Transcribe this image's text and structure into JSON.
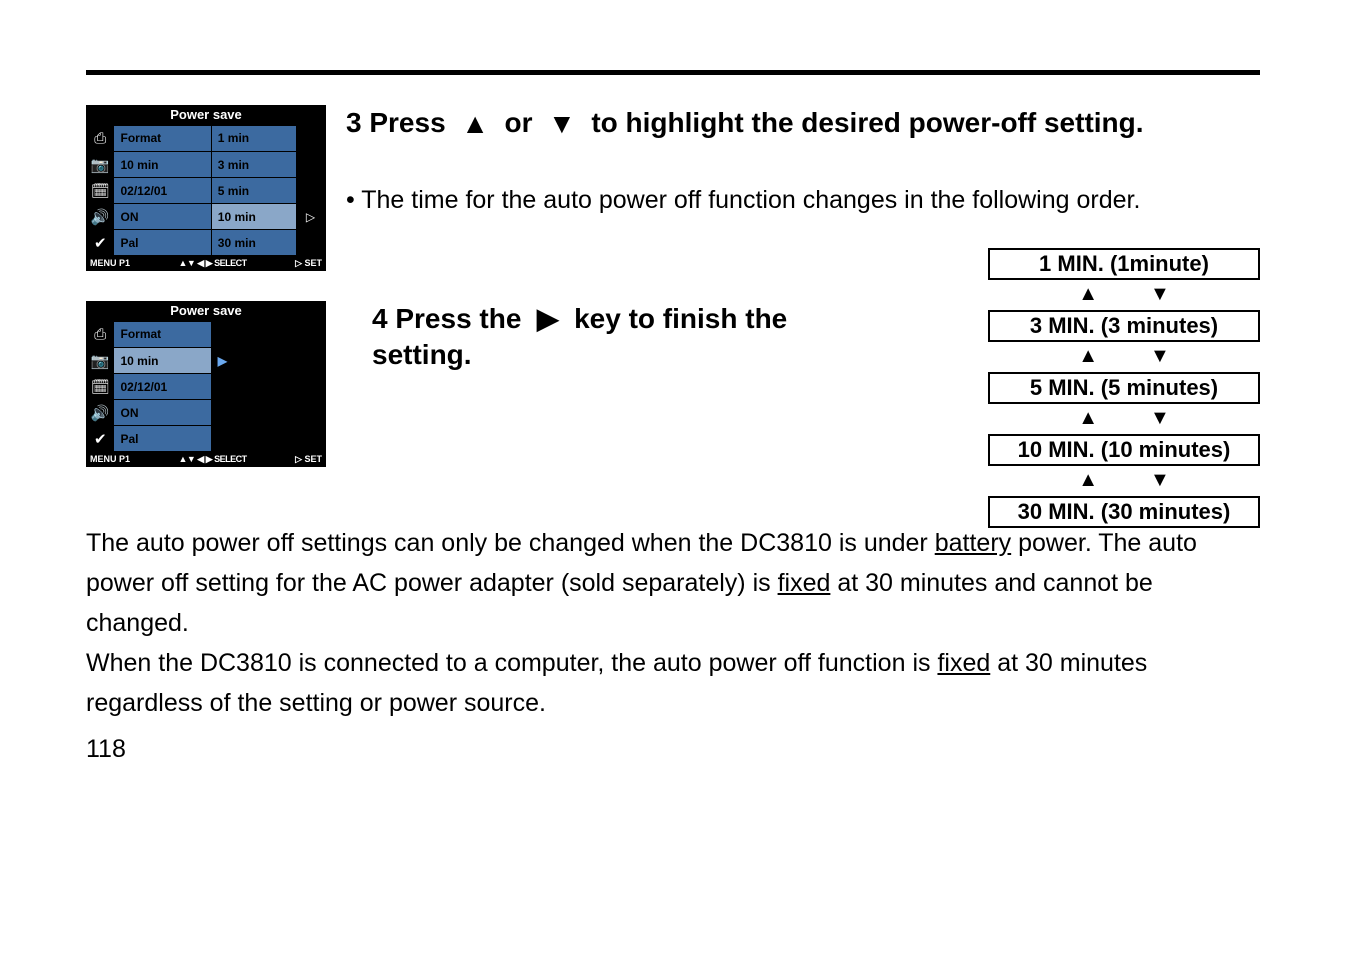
{
  "lcd1": {
    "title": "Power save",
    "rows": [
      {
        "label": "Format",
        "value": "1 min"
      },
      {
        "label": "10 min",
        "value": "3 min"
      },
      {
        "label": "02/12/01",
        "value": "5 min"
      },
      {
        "label": "ON",
        "value": "10 min",
        "selected": true,
        "arrow": "▷"
      },
      {
        "label": "Pal",
        "value": "30 min"
      }
    ],
    "footer": {
      "left": "MENU P1",
      "mid": "▲▼ ◀ ▶ SELECT",
      "right": "▷ SET"
    }
  },
  "lcd2": {
    "title": "Power save",
    "rows": [
      {
        "label": "Format"
      },
      {
        "label": "10 min",
        "selected": true,
        "arrow": "▶"
      },
      {
        "label": "02/12/01"
      },
      {
        "label": "ON"
      },
      {
        "label": "Pal"
      }
    ],
    "footer": {
      "left": "MENU P1",
      "mid": "▲▼ ◀ ▶ SELECT",
      "right": "▷ SET"
    }
  },
  "step3": {
    "num": "3",
    "heading_a": "Press",
    "heading_b": "or",
    "heading_c": "to highlight the desired power-off setting.",
    "bullet": "• The time for the auto power off function changes in the following order."
  },
  "step4": {
    "num": "4",
    "heading_a": "Press the",
    "heading_b": "key to finish the setting."
  },
  "ladder": [
    "1 MIN. (1minute)",
    "3 MIN. (3 minutes)",
    "5 MIN. (5 minutes)",
    "10 MIN. (10 minutes)",
    "30 MIN. (30 minutes)"
  ],
  "para1a": "The auto power off settings can only be changed when the DC3810 is under ",
  "para1_u1": "battery",
  "para1b": " power. The auto power off setting for the AC power adapter (sold separately) is ",
  "para1_u2": "fixed",
  "para1c": " at 30 minutes and cannot be changed.",
  "para2a": "When the DC3810 is connected to a computer, the auto power off function is ",
  "para2_u1": "fixed",
  "para2b": " at 30 minutes regardless of the setting or power source.",
  "page": "118",
  "icons": [
    "⎙",
    "📷",
    "🗓",
    "🔊",
    "✔"
  ]
}
